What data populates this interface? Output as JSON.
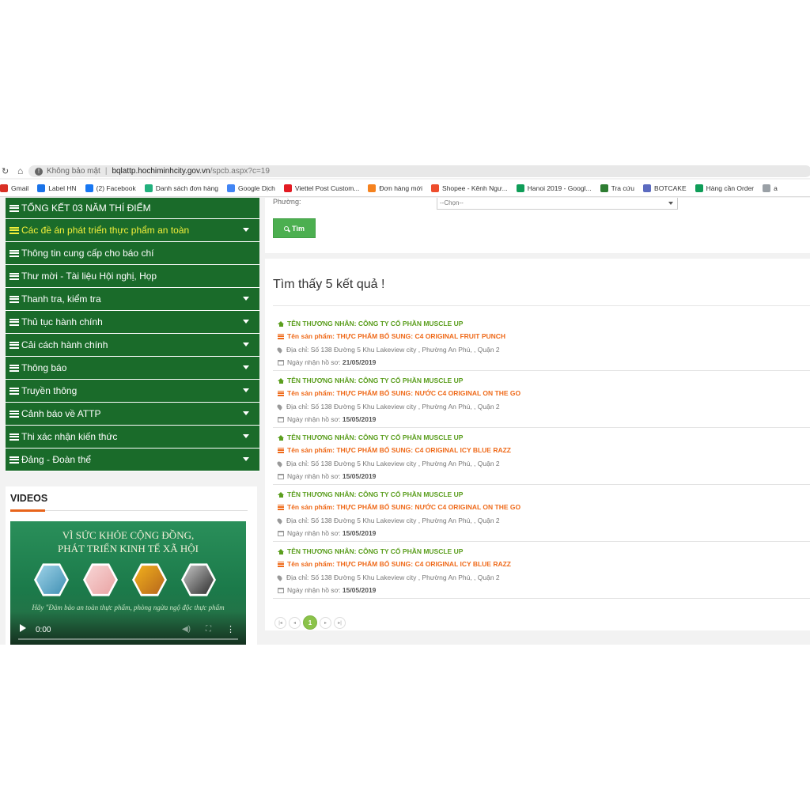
{
  "browser": {
    "not_secure": "Không bảo mật",
    "url_host": "bqlattp.hochiminhcity.gov.vn",
    "url_path": "/spcb.aspx?c=19"
  },
  "bookmarks": [
    {
      "label": "Gmail",
      "color": "#d93025"
    },
    {
      "label": "Label HN",
      "color": "#1a73e8"
    },
    {
      "label": "(2) Facebook",
      "color": "#1877f2"
    },
    {
      "label": "Danh sách đơn hàng",
      "color": "#22b07d"
    },
    {
      "label": "Google Dịch",
      "color": "#4285f4"
    },
    {
      "label": "Viettel Post Custom...",
      "color": "#e31b23"
    },
    {
      "label": "Đơn hàng mới",
      "color": "#f5821f"
    },
    {
      "label": "Shopee - Kênh Ngư...",
      "color": "#ee4d2d"
    },
    {
      "label": "Hanoi 2019 - Googl...",
      "color": "#0f9d58"
    },
    {
      "label": "Tra cứu",
      "color": "#2e7d32"
    },
    {
      "label": "BOTCAKE",
      "color": "#5c6bc0"
    },
    {
      "label": "Hàng cần Order",
      "color": "#0f9d58"
    },
    {
      "label": "a",
      "color": "#9aa0a6"
    }
  ],
  "sidebar": {
    "items": [
      {
        "label": "TỔNG KẾT 03 NĂM THÍ ĐIỂM",
        "caret": false
      },
      {
        "label": "Các đề án phát triển thực phẩm an toàn",
        "caret": true,
        "active": true
      },
      {
        "label": "Thông tin cung cấp cho báo chí",
        "caret": false
      },
      {
        "label": "Thư mời - Tài liệu Hội nghị, Họp",
        "caret": false
      },
      {
        "label": "Thanh tra, kiểm tra",
        "caret": true
      },
      {
        "label": "Thủ tục hành chính",
        "caret": true
      },
      {
        "label": "Cải cách hành chính",
        "caret": true
      },
      {
        "label": "Thông báo",
        "caret": true
      },
      {
        "label": "Truyền thông",
        "caret": true
      },
      {
        "label": "Cảnh báo về ATTP",
        "caret": true
      },
      {
        "label": "Thi xác nhận kiến thức",
        "caret": true
      },
      {
        "label": "Đảng - Đoàn thể",
        "caret": true
      }
    ]
  },
  "videos": {
    "title": "VIDEOS",
    "poster_line1": "VÌ SỨC KHỎE CỘNG ĐỒNG,",
    "poster_line2": "PHÁT TRIỂN KINH TẾ XÃ HỘI",
    "poster_quote": "Hãy \"Đảm bảo an toàn thực phẩm, phòng ngừa ngộ độc thực phẩm",
    "time": "0:00"
  },
  "search": {
    "ward_label": "Phường:",
    "ward_value": "--Chọn--",
    "button_label": "Tìm"
  },
  "results": {
    "title": "Tìm thấy 5 kết quả !",
    "items": [
      {
        "merchant": "TÊN THƯƠNG NHÂN: CÔNG TY CỔ PHẦN MUSCLE UP",
        "product": "Tên sản phẩm: THỰC PHẨM BỔ SUNG: C4 ORIGINAL FRUIT PUNCH",
        "address": "Địa chỉ: Số 138 Đường 5 Khu Lakeview city , Phường An Phú, , Quận 2",
        "date_label": "Ngày nhận hồ sơ:",
        "date": "21/05/2019"
      },
      {
        "merchant": "TÊN THƯƠNG NHÂN: CÔNG TY CỔ PHẦN MUSCLE UP",
        "product": "Tên sản phẩm: THỰC PHẨM BỔ SUNG: NƯỚC C4 ORIGINAL ON THE GO",
        "address": "Địa chỉ: Số 138 Đường 5 Khu Lakeview city , Phường An Phú, , Quận 2",
        "date_label": "Ngày nhận hồ sơ:",
        "date": "15/05/2019"
      },
      {
        "merchant": "TÊN THƯƠNG NHÂN: CÔNG TY CỔ PHẦN MUSCLE UP",
        "product": "Tên sản phẩm: THỰC PHẨM BỔ SUNG: C4 ORIGINAL ICY BLUE RAZZ",
        "address": "Địa chỉ: Số 138 Đường 5 Khu Lakeview city , Phường An Phú, , Quận 2",
        "date_label": "Ngày nhận hồ sơ:",
        "date": "15/05/2019"
      },
      {
        "merchant": "TÊN THƯƠNG NHÂN: CÔNG TY CỔ PHẦN MUSCLE UP",
        "product": "Tên sản phẩm: THỰC PHẨM BỔ SUNG: NƯỚC C4 ORIGINAL ON THE GO",
        "address": "Địa chỉ: Số 138 Đường 5 Khu Lakeview city , Phường An Phú, , Quận 2",
        "date_label": "Ngày nhận hồ sơ:",
        "date": "15/05/2019"
      },
      {
        "merchant": "TÊN THƯƠNG NHÂN: CÔNG TY CỔ PHẦN MUSCLE UP",
        "product": "Tên sản phẩm: THỰC PHẨM BỔ SUNG: C4 ORIGINAL ICY BLUE RAZZ",
        "address": "Địa chỉ: Số 138 Đường 5 Khu Lakeview city , Phường An Phú, , Quận 2",
        "date_label": "Ngày nhận hồ sơ:",
        "date": "15/05/2019"
      }
    ]
  },
  "pager": {
    "current_page": "1"
  }
}
